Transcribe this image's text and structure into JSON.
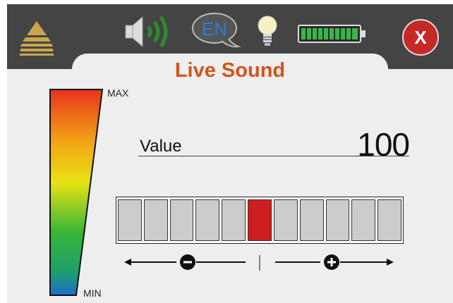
{
  "header": {
    "logo_icon": "pyramid-logo-icon",
    "sound_icon": "speaker-volume-icon",
    "language": "EN",
    "light_icon": "lightbulb-icon",
    "battery_icon": "battery-full-icon",
    "close_label": "X"
  },
  "title": "Live Sound",
  "meter": {
    "max_label": "MAX",
    "min_label": "MIN"
  },
  "value": {
    "label": "Value",
    "number": "100"
  },
  "slider": {
    "segment_count": 11,
    "active_segment": 6,
    "decrease_icon": "minus-circle-icon",
    "increase_icon": "plus-circle-icon"
  },
  "colors": {
    "accent": "#d2541b",
    "active_segment": "#cc1f1f",
    "close_button": "#c62828",
    "battery": "#39b54a",
    "topbar": "#444444"
  }
}
